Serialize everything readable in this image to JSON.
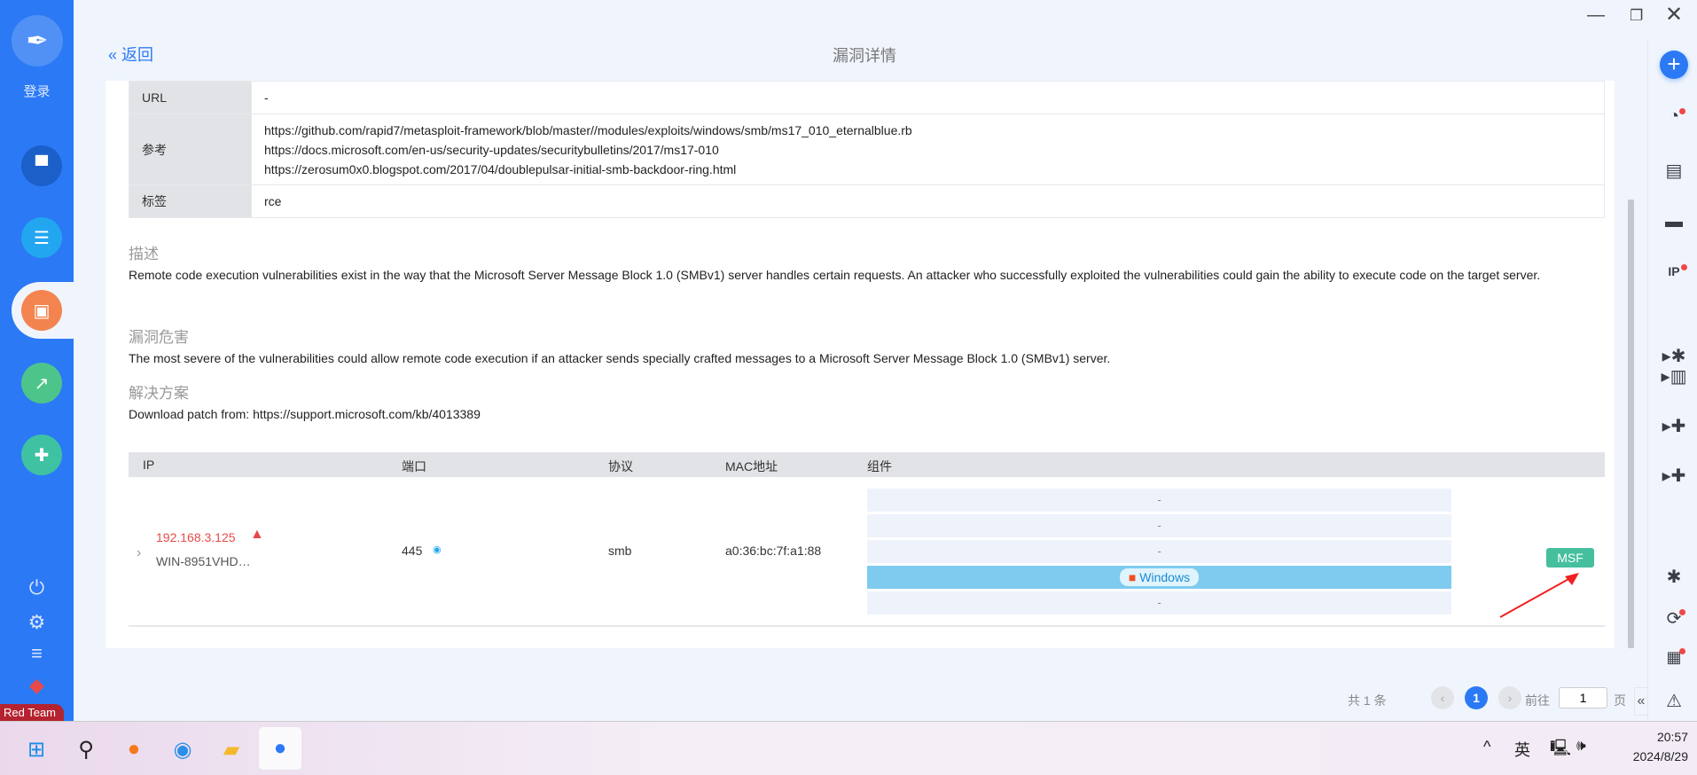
{
  "sidebar": {
    "login": "登录",
    "badge": "Red Team",
    "nav": [
      "profile",
      "server",
      "report",
      "monitor",
      "plugin"
    ]
  },
  "header": {
    "back": "返回",
    "title": "漏洞详情"
  },
  "info": {
    "url_label": "URL",
    "url_value": "-",
    "ref_label": "参考",
    "refs": [
      "https://github.com/rapid7/metasploit-framework/blob/master//modules/exploits/windows/smb/ms17_010_eternalblue.rb",
      "https://docs.microsoft.com/en-us/security-updates/securitybulletins/2017/ms17-010",
      "https://zerosum0x0.blogspot.com/2017/04/doublepulsar-initial-smb-backdoor-ring.html"
    ],
    "tag_label": "标签",
    "tag_value": "rce"
  },
  "desc": {
    "heading": "描述",
    "text": "Remote code execution vulnerabilities exist in the way that the Microsoft Server Message Block 1.0 (SMBv1) server handles certain requests. An attacker who successfully exploited the vulnerabilities could gain the ability to execute code on the target server."
  },
  "harm": {
    "heading": "漏洞危害",
    "text": "The most severe of the vulnerabilities could allow remote code execution if an attacker sends specially crafted messages to a Microsoft Server Message Block 1.0 (SMBv1) server."
  },
  "solution": {
    "heading": "解决方案",
    "text": "Download patch from: https://support.microsoft.com/kb/4013389"
  },
  "table": {
    "headers": [
      "IP",
      "端口",
      "协议",
      "MAC地址",
      "组件"
    ],
    "row": {
      "ip": "192.168.3.125",
      "host": "WIN-8951VHD…",
      "port": "445",
      "protocol": "smb",
      "mac": "a0:36:bc:7f:a1:88",
      "components": [
        "-",
        "-",
        "-",
        "Windows",
        "-"
      ],
      "action": "MSF"
    }
  },
  "pagination": {
    "total": "共 1 条",
    "current": "1",
    "goto": "前往",
    "page_input": "1",
    "page_suffix": "页"
  },
  "taskbar": {
    "ime": "英",
    "time": "20:57",
    "date": "2024/8/29"
  },
  "colors": {
    "accent": "#2b79f5",
    "danger": "#e84a4a",
    "msf": "#45bf9d"
  }
}
